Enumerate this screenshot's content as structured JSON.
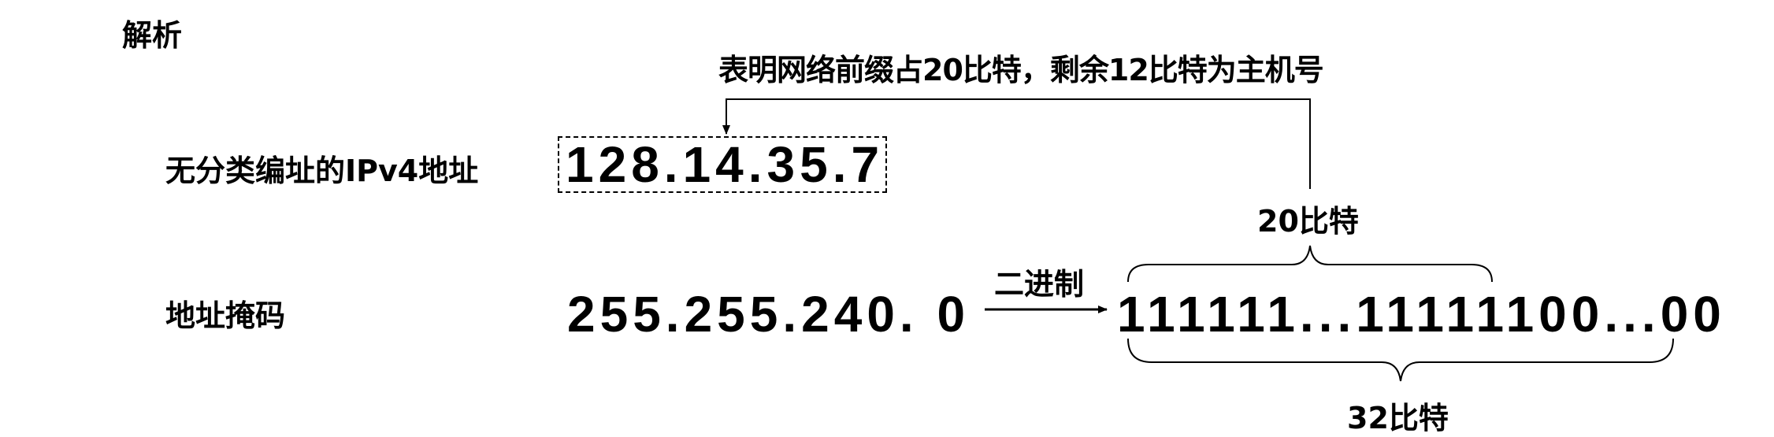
{
  "title": "解析",
  "prefix_note": "表明网络前缀占20比特，剩余12比特为主机号",
  "ip_label": "无分类编址的IPv4地址",
  "ip_value": "128.14.35.7",
  "mask_label": "地址掩码",
  "mask_value": "255.255.240. 0",
  "conversion_label": "二进制",
  "binary_value": "111111...11111100...00",
  "prefix_bits_label": "20比特",
  "total_bits_label": "32比特"
}
